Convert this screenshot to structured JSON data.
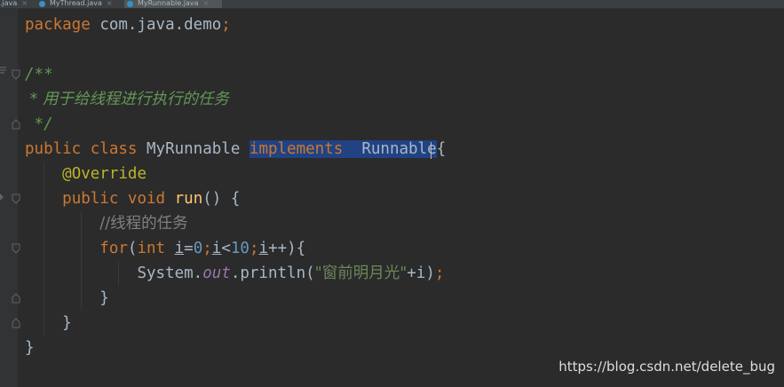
{
  "tabs": [
    {
      "label": ".java",
      "close": "×"
    },
    {
      "label": "MyThread.java",
      "close": "×"
    },
    {
      "label": "MyRunnable.java",
      "close": "×"
    }
  ],
  "code": {
    "l1": {
      "kw": "package",
      "pkg": "com.java.demo",
      "semi": ";"
    },
    "l3": {
      "doc": "/**"
    },
    "l4": {
      "doc": " * 用于给线程进行执行的任务"
    },
    "l5": {
      "doc": " */"
    },
    "l6": {
      "kw1": "public",
      "kw2": "class",
      "name": "MyRunnable",
      "impl": "implements",
      "iface": "Runnable",
      "brace": "{"
    },
    "l7": {
      "annotation": "@Override"
    },
    "l8": {
      "kw1": "public",
      "kw2": "void",
      "method": "run",
      "rest": "() {"
    },
    "l9": {
      "comment": "//线程的任务"
    },
    "l10": {
      "for": "for",
      "open": "(",
      "int": "int",
      "i1": "i",
      "eq": "=",
      "zero": "0",
      "semi1": ";",
      "i2": "i",
      "lt": "<",
      "ten": "10",
      "semi2": ";",
      "i3": "i",
      "inc": "++",
      "close": "){"
    },
    "l11": {
      "sys": "System.",
      "out": "out",
      "call": ".println(",
      "str": "\"窗前明月光\"",
      "plus": "+i)",
      "semi": ";"
    },
    "l12": {
      "brace": "}"
    },
    "l13": {
      "brace": "}"
    },
    "l14": {
      "brace": "}"
    }
  },
  "watermark": "https://blog.csdn.net/delete_bug",
  "colors": {
    "background": "#2b2b2b",
    "keyword": "#cc7832",
    "text": "#a9b7c6",
    "method": "#ffc66d",
    "number": "#6897bb",
    "string": "#6a8759",
    "comment": "#808080",
    "doc_comment": "#629755",
    "annotation": "#bbb529",
    "static_field": "#9876aa",
    "selection": "#214283"
  }
}
